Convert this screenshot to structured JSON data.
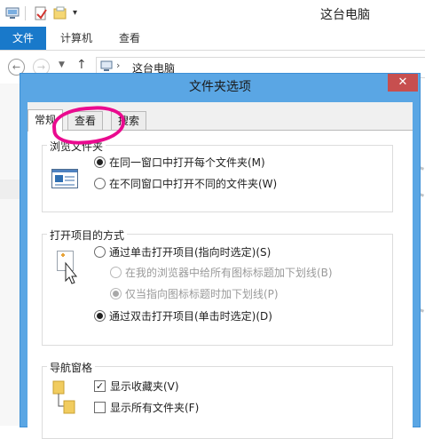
{
  "window": {
    "title": "这台电脑"
  },
  "ribbon": {
    "tabs": [
      "文件",
      "计算机",
      "查看"
    ]
  },
  "address": {
    "path": "这台电脑"
  },
  "dialog": {
    "title": "文件夹选项",
    "close_glyph": "✕",
    "tabs": [
      "常规",
      "查看",
      "搜索"
    ],
    "active_tab": "常规",
    "annotation": "hand-drawn pink circle around 查看 tab",
    "browse_group": {
      "title": "浏览文件夹",
      "options": [
        {
          "label": "在同一窗口中打开每个文件夹(M)",
          "selected": true
        },
        {
          "label": "在不同窗口中打开不同的文件夹(W)",
          "selected": false
        }
      ]
    },
    "open_group": {
      "title": "打开项目的方式",
      "options": [
        {
          "label": "通过单击打开项目(指向时选定)(S)",
          "selected": false,
          "enabled": true
        },
        {
          "label": "在我的浏览器中给所有图标标题加下划线(B)",
          "selected": false,
          "enabled": false
        },
        {
          "label": "仅当指向图标标题时加下划线(P)",
          "selected": true,
          "enabled": false
        },
        {
          "label": "通过双击打开项目(单击时选定)(D)",
          "selected": true,
          "enabled": true
        }
      ]
    },
    "nav_group": {
      "title": "导航窗格",
      "options": [
        {
          "label": "显示收藏夹(V)",
          "checked": true
        },
        {
          "label": "显示所有文件夹(F)",
          "checked": false
        }
      ]
    }
  },
  "colors": {
    "ribbon_accent": "#1979ca",
    "dialog_frame": "#5aa6e4",
    "close_button": "#c74f4f",
    "annotation": "#ea0a8f"
  },
  "icons": [
    "computer-icon",
    "properties-icon",
    "new-folder-icon",
    "dropdown-icon",
    "back-icon",
    "forward-icon",
    "recent-icon",
    "up-icon",
    "close-icon",
    "window-icon",
    "pointer-icon",
    "folder-tree-icon"
  ]
}
